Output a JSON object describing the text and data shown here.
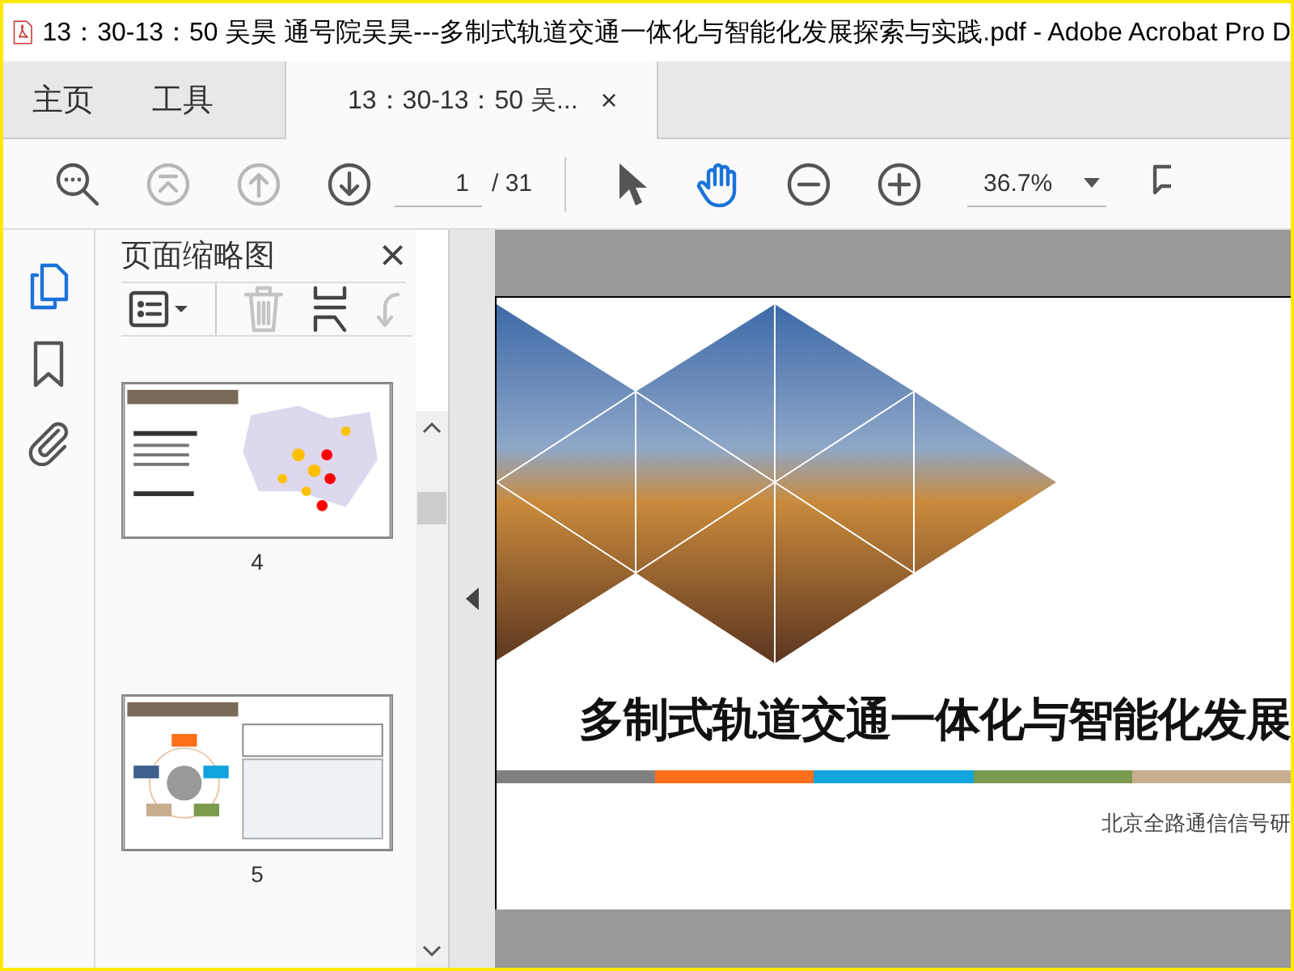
{
  "window": {
    "title": "13：30-13：50  吴昊  通号院吴昊---多制式轨道交通一体化与智能化发展探索与实践.pdf - Adobe Acrobat Pro D"
  },
  "nav_tabs": [
    {
      "label": "主页",
      "selected": false
    },
    {
      "label": "工具",
      "selected": false
    },
    {
      "label": "13：30-13：50  吴...",
      "selected": true,
      "close": "×"
    }
  ],
  "toolbar": {
    "buttons": [
      {
        "kind": "zoom-search",
        "disabled": false,
        "selected": false
      },
      {
        "kind": "first-page",
        "disabled": true,
        "selected": false
      },
      {
        "kind": "prev-page",
        "disabled": true,
        "selected": false
      },
      {
        "kind": "next-page",
        "disabled": false,
        "selected": false
      },
      {
        "kind": "page-field",
        "disabled": false,
        "selected": false
      },
      {
        "kind": "pointer",
        "disabled": false,
        "selected": false
      },
      {
        "kind": "hand",
        "disabled": false,
        "selected": true
      },
      {
        "kind": "zoom-out",
        "disabled": false,
        "selected": false
      },
      {
        "kind": "zoom-in",
        "disabled": false,
        "selected": false
      },
      {
        "kind": "zoom-field",
        "disabled": false,
        "selected": false
      },
      {
        "kind": "more",
        "disabled": false,
        "selected": false
      }
    ],
    "page_current": "1",
    "page_total": "/ 31",
    "zoom": "36.7%"
  },
  "side_rail": [
    {
      "kind": "pages",
      "selected": true
    },
    {
      "kind": "bookmark",
      "selected": false
    },
    {
      "kind": "attachment",
      "selected": false
    }
  ],
  "thumbnail_panel": {
    "title": "页面缩略图",
    "close": "×",
    "tools": [
      {
        "kind": "options",
        "disabled": false
      },
      {
        "kind": "delete",
        "disabled": true
      },
      {
        "kind": "insert",
        "disabled": false
      },
      {
        "kind": "rotate",
        "disabled": true
      }
    ],
    "pages": [
      {
        "kind": "map",
        "label": "4"
      },
      {
        "kind": "diagram",
        "label": "5"
      }
    ]
  },
  "document": {
    "title": "多制式轨道交通一体化与智能化发展",
    "subtitle": "北京全路通信信号研",
    "stripes": [
      {
        "color": "#808080"
      },
      {
        "color": "#ff6f1a"
      },
      {
        "color": "#11a4dd"
      },
      {
        "color": "#7a9a4e"
      },
      {
        "color": "#c8ad90"
      }
    ]
  }
}
